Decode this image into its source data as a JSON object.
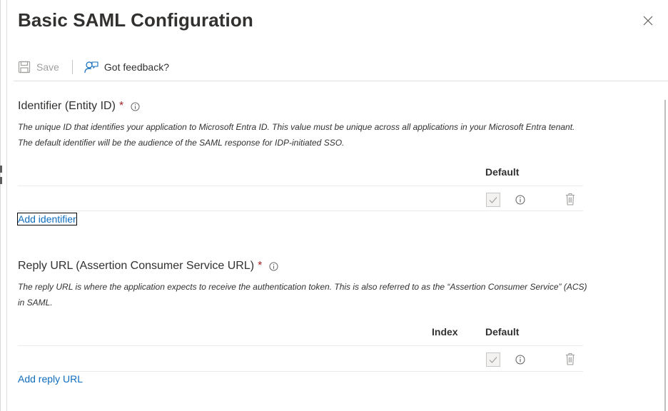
{
  "panel": {
    "title": "Basic SAML Configuration"
  },
  "toolbar": {
    "save_label": "Save",
    "feedback_label": "Got feedback?"
  },
  "identifier": {
    "title": "Identifier (Entity ID)",
    "required_mark": "*",
    "description": "The unique ID that identifies your application to Microsoft Entra ID. This value must be unique across all applications in your Microsoft Entra tenant. The default identifier will be the audience of the SAML response for IDP-initiated SSO.",
    "column_default": "Default",
    "default_checked": true,
    "add_link": "Add identifier"
  },
  "reply_url": {
    "title": "Reply URL (Assertion Consumer Service URL)",
    "required_mark": "*",
    "description": "The reply URL is where the application expects to receive the authentication token. This is also referred to as the “Assertion Consumer Service” (ACS) in SAML.",
    "column_index": "Index",
    "column_default": "Default",
    "default_checked": true,
    "add_link": "Add reply URL"
  },
  "colors": {
    "link": "#0f6cbd",
    "required": "#a4262c",
    "disabled": "#a19f9d"
  }
}
